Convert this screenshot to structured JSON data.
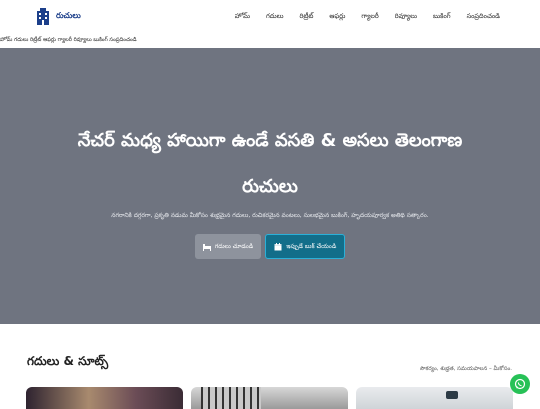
{
  "header": {
    "brand": "రుచులు",
    "nav": [
      "హోమ్",
      "గదులు",
      "రిట్రీట్",
      "ఆఫర్లు",
      "గ్యాలరీ",
      "రివ్యూలు",
      "బుకింగ్",
      "సంప్రదించండి"
    ]
  },
  "subnav": "హోమ్ గదులు రిట్రీట్ ఆఫర్లు గ్యాలరీ రివ్యూలు బుకింగ్ సంప్రదించండి",
  "hero": {
    "title_line1": "నేచర్ మధ్య హాయిగా ఉండే వసతి & అసలు తెలంగాణ",
    "title_line2": "రుచులు",
    "subtitle": "నగరానికి దగ్గరగా, ప్రకృతి నడుమ మీకోసం శుభ్రమైన గదులు, రుచికరమైన వంటలు, సులభమైన బుకింగ్, హృదయపూర్వక అతిథి సత్కారం.",
    "btn_rooms": "గదులు చూడండి",
    "btn_book": "ఇప్పుడే బుక్ చేయండి"
  },
  "rooms": {
    "title": "గదులు & సూట్స్",
    "note": "సౌకర్యం, శుభ్రత, సమయపాలన – మీకోసం."
  },
  "icons": {
    "logo": "building-logo-icon",
    "bed": "bed-icon",
    "calendar": "calendar-icon",
    "whatsapp": "whatsapp-icon"
  },
  "colors": {
    "brand": "#1c3f8a",
    "hero_bg": "#6f7480",
    "primary_button": "#126e8a",
    "whatsapp": "#27c157"
  }
}
